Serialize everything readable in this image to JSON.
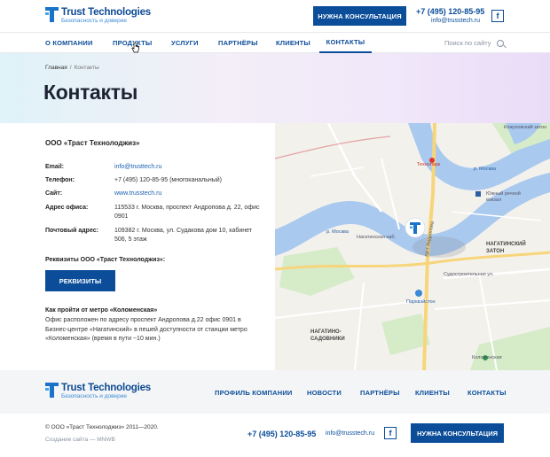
{
  "header": {
    "logo_title": "Trust Technologies",
    "logo_subtitle": "Безопасность и доверие",
    "consult_label": "Нужна консультация",
    "phone": "+7 (495) 120-85-95",
    "email": "info@trusstech.ru",
    "fb_glyph": "f"
  },
  "nav": {
    "items": [
      {
        "label": "О компании"
      },
      {
        "label": "Продукты"
      },
      {
        "label": "Услуги"
      },
      {
        "label": "Партнёры"
      },
      {
        "label": "Клиенты"
      },
      {
        "label": "Контакты",
        "active": true
      }
    ],
    "search_placeholder": "Поиск по сайту"
  },
  "hero": {
    "breadcrumb_home": "Главная",
    "breadcrumb_sep": "/",
    "breadcrumb_current": "Контакты",
    "title": "Контакты"
  },
  "contacts": {
    "company": "ООО «Траст Технолоджиз»",
    "rows": [
      {
        "key": "Email:",
        "value": "info@trusttech.ru"
      },
      {
        "key": "Телефон:",
        "value": "+7 (495) 120-85-95 (многоканальный)"
      },
      {
        "key": "Сайт:",
        "value": "www.trusstech.ru"
      },
      {
        "key": "Адрес офиса:",
        "value": "115533 г. Москва, проспект Андропова д. 22, офис 0901"
      },
      {
        "key": "Почтовый адрес:",
        "value": "109382 г. Москва, ул. Судакова дом 10, кабинет 506, 5 этаж"
      }
    ],
    "requisites_title": "Реквизиты ООО «Траст Технолоджиз»:",
    "requisites_button": "Реквизиты",
    "metro_title": "Как пройти от метро «Коломенская»",
    "metro_text": "Офис расположен по адресу проспект Андропова д.22 офис 0901 в Бизнес-центре «Нагатинский» в пешей доступности от станции метро «Коломенская» (время в пути ~10 мин.)"
  },
  "map": {
    "labels": {
      "technopark": "Технопарк",
      "kozhukhovsky": "Кожуховский затон",
      "south_port": "Южный речной вокзал",
      "nagatinsky": "НАГАТИНСКИЙ ЗАТОН",
      "nagatino": "НАГАТИНО-САДОВНИКИ",
      "kolomenskaya": "Коломенская",
      "moskva1": "р. Москва",
      "moskva2": "р. Москва",
      "nagatinskaya_nab": "Нагатинская наб.",
      "andropova": "пр-т Андропова",
      "sudostroitelnaya": "Судостроительная ул.",
      "parkway": "Парквэйстон"
    },
    "water_color": "#a9c9ef",
    "land_color": "#f3f1ec",
    "park_color": "#d6ebc8",
    "road_color": "#f7d57a"
  },
  "footer": {
    "logo_title": "Trust Technologies",
    "logo_subtitle": "Безопасность и доверие",
    "nav": [
      {
        "label": "Профиль компании"
      },
      {
        "label": "Новости"
      },
      {
        "label": "Партнёры"
      },
      {
        "label": "Клиенты"
      },
      {
        "label": "Контакты"
      }
    ],
    "copyright": "© ООО «Траст Технолоджиз» 2011—2020.",
    "credit": "Создание сайта — MNWB",
    "phone": "+7 (495) 120-85-95",
    "email": "info@trusstech.ru",
    "fb_glyph": "f",
    "consult_label": "Нужна консультация"
  },
  "colors": {
    "brand": "#0b4d99",
    "accent": "#1a73c8"
  }
}
